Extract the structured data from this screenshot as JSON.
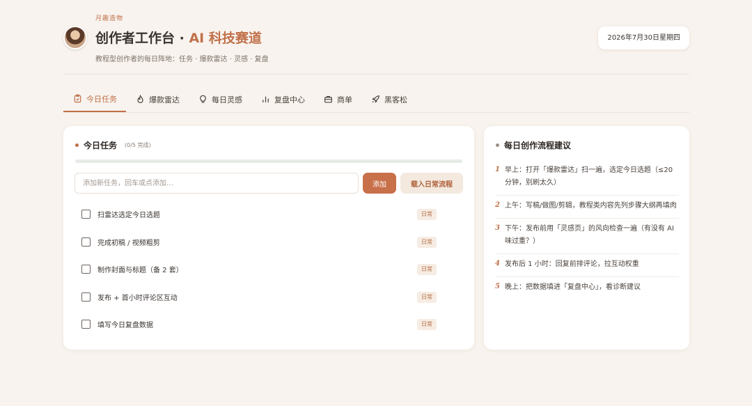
{
  "header": {
    "brand_tag": "月趣造物",
    "title_main": "创作者工作台 · ",
    "title_accent": "AI 科技赛道",
    "subtitle": "教程型创作者的每日阵地：任务 · 爆款雷达 · 灵感 · 复盘",
    "date": "2026年7月30日星期四"
  },
  "tabs": [
    {
      "label": "今日任务",
      "icon": "clipboard-icon",
      "active": true
    },
    {
      "label": "爆款雷达",
      "icon": "flame-icon",
      "active": false
    },
    {
      "label": "每日灵感",
      "icon": "lightbulb-icon",
      "active": false
    },
    {
      "label": "复盘中心",
      "icon": "bar-chart-icon",
      "active": false
    },
    {
      "label": "商单",
      "icon": "briefcase-icon",
      "active": false
    },
    {
      "label": "黑客松",
      "icon": "rocket-icon",
      "active": false
    }
  ],
  "tasks_card": {
    "title": "今日任务",
    "count": "(0/5 完成)",
    "progress": 0,
    "input_placeholder": "添加新任务，回车或点添加…",
    "input_value": "",
    "add_label": "添加",
    "load_label": "载入日常流程",
    "items": [
      {
        "text": "扫雷达选定今日选题",
        "tag": "日常",
        "done": false
      },
      {
        "text": "完成初稿 / 视频粗剪",
        "tag": "日常",
        "done": false
      },
      {
        "text": "制作封面与标题（备 2 套）",
        "tag": "日常",
        "done": false
      },
      {
        "text": "发布 + 首小时评论区互动",
        "tag": "日常",
        "done": false
      },
      {
        "text": "填写今日复盘数据",
        "tag": "日常",
        "done": false
      }
    ]
  },
  "flow_card": {
    "title": "每日创作流程建议",
    "items": [
      {
        "num": "1",
        "text": "早上：打开「爆款雷达」扫一遍，选定今日选题（≤20 分钟，别刷太久）"
      },
      {
        "num": "2",
        "text": "上午：写稿/做图/剪辑，教程类内容先列步骤大纲再填肉"
      },
      {
        "num": "3",
        "text": "下午：发布前用「灵感页」的风向检查一遍（有没有 AI 味过重？）"
      },
      {
        "num": "4",
        "text": "发布后 1 小时：回复前排评论，拉互动权重"
      },
      {
        "num": "5",
        "text": "晚上：把数据填进「复盘中心」，看诊断建议"
      }
    ]
  },
  "colors": {
    "accent": "#c0714a",
    "background": "#f8f3ee",
    "card": "#ffffff"
  }
}
